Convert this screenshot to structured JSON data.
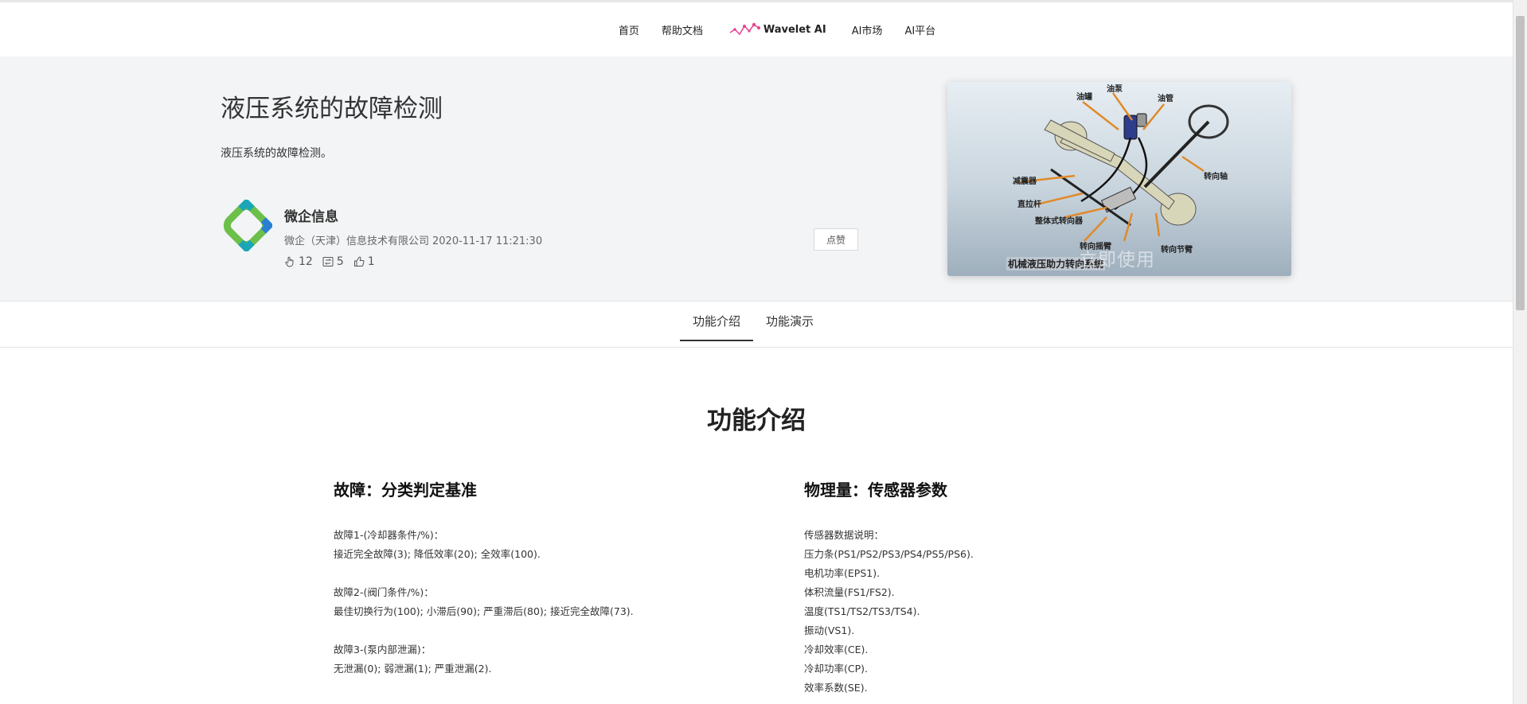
{
  "nav": {
    "items": [
      "首页",
      "帮助文档"
    ],
    "brand": "Wavelet AI",
    "items_after": [
      "AI市场",
      "AI平台"
    ]
  },
  "hero": {
    "title": "液压系统的故障检测",
    "description": "液压系统的故障检测。",
    "author": {
      "name": "微企信息",
      "company": "微企（天津）信息技术有限公司",
      "datetime": "2020-11-17 11:21:30"
    },
    "stats": {
      "uses": "12",
      "forks": "5",
      "likes": "1"
    },
    "like_button": "点赞",
    "image": {
      "caption": "机械液压助力转向系统",
      "overlay_button": "立即使用",
      "labels": [
        "油罐",
        "油泵",
        "油管",
        "减震器",
        "直拉杆",
        "整体式转向器",
        "转向摇臂",
        "转向节臂",
        "转向轴"
      ]
    }
  },
  "tabs": [
    "功能介绍",
    "功能演示"
  ],
  "content": {
    "section_title": "功能介绍",
    "left": {
      "heading": "故障：分类判定基准",
      "groups": [
        [
          "故障1-(冷却器条件/%)：",
          "接近完全故障(3); 降低效率(20); 全效率(100)."
        ],
        [
          "故障2-(阀门条件/%)：",
          "最佳切换行为(100); 小滞后(90); 严重滞后(80); 接近完全故障(73)."
        ],
        [
          "故障3-(泵内部泄漏)：",
          "无泄漏(0); 弱泄漏(1); 严重泄漏(2)."
        ]
      ]
    },
    "right": {
      "heading": "物理量：传感器参数",
      "lines": [
        "传感器数据说明：",
        "压力条(PS1/PS2/PS3/PS4/PS5/PS6).",
        "电机功率(EPS1).",
        "体积流量(FS1/FS2).",
        "温度(TS1/TS2/TS3/TS4).",
        "振动(VS1).",
        "冷却效率(CE).",
        "冷却功率(CP).",
        "效率系数(SE)."
      ]
    }
  },
  "colors": {
    "hero_bg": "#f3f4f6",
    "brand_logo": "#e84393",
    "avatar_green": "#6cc04a",
    "avatar_teal": "#1aa6b7",
    "image_arrows": "#e08a2a"
  }
}
